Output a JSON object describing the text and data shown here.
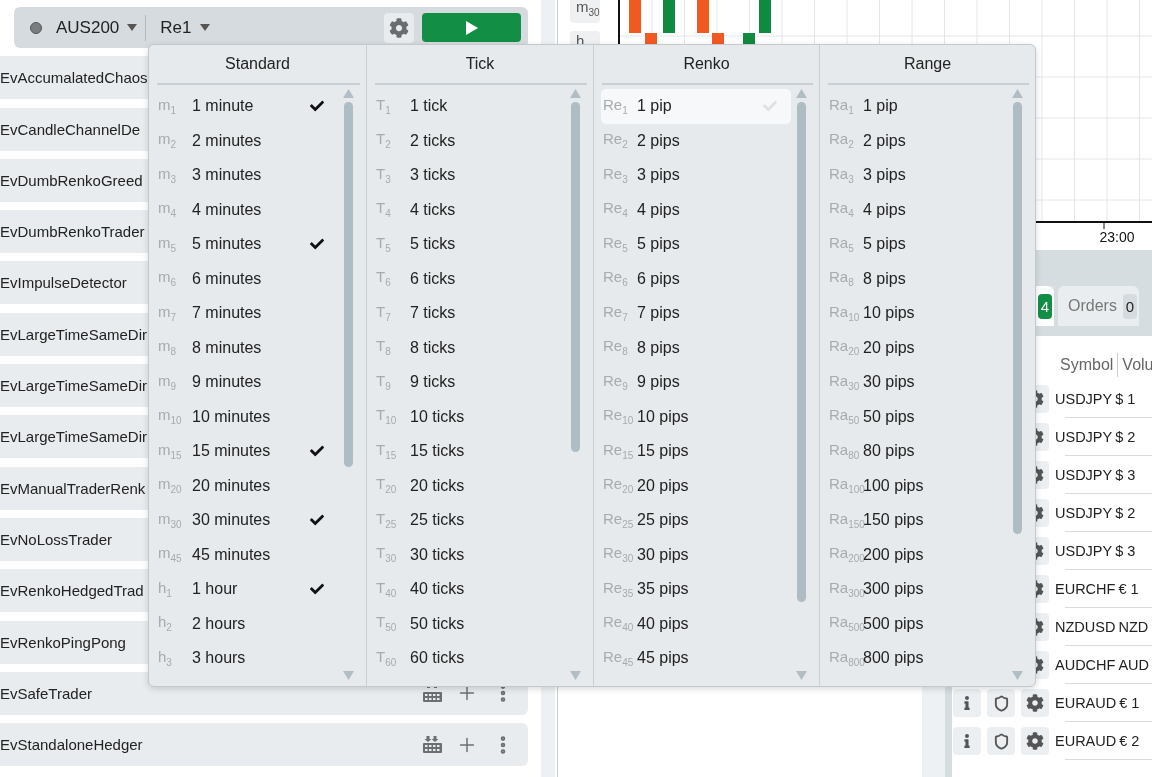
{
  "toolbar": {
    "symbol": "AUS200",
    "chart_type": "Re1"
  },
  "strategies": [
    {
      "name": "EvAccumalatedChaos"
    },
    {
      "name": "EvCandleChannelDe"
    },
    {
      "name": "EvDumbRenkoGreed"
    },
    {
      "name": "EvDumbRenkoTrader"
    },
    {
      "name": "EvImpulseDetector"
    },
    {
      "name": "EvLargeTimeSameDir"
    },
    {
      "name": "EvLargeTimeSameDir"
    },
    {
      "name": "EvLargeTimeSameDir"
    },
    {
      "name": "EvManualTraderRenk"
    },
    {
      "name": "EvNoLossTrader"
    },
    {
      "name": "EvRenkoHedgedTrad"
    },
    {
      "name": "EvRenkoPingPong"
    },
    {
      "name": "EvSafeTrader"
    },
    {
      "name": "EvStandaloneHedger"
    }
  ],
  "chart": {
    "timeframes": [
      {
        "prefix": "m",
        "sub": "30"
      },
      {
        "prefix": "h"
      }
    ],
    "time_label": "23:00"
  },
  "bottom_tabs": [
    {
      "badge": "4",
      "selected": true
    },
    {
      "label": "Orders",
      "badge": "0",
      "selected": false
    }
  ],
  "positions": {
    "columns": [
      "Symbol",
      "Volu"
    ],
    "rows": [
      {
        "symbol": "USDJPY",
        "volume": "$ 1"
      },
      {
        "symbol": "USDJPY",
        "volume": "$ 2"
      },
      {
        "symbol": "USDJPY",
        "volume": "$ 3"
      },
      {
        "symbol": "USDJPY",
        "volume": "$ 2"
      },
      {
        "symbol": "USDJPY",
        "volume": "$ 3"
      },
      {
        "symbol": "EURCHF",
        "volume": "€ 1"
      },
      {
        "symbol": "NZDUSD",
        "volume": "NZD"
      },
      {
        "symbol": "AUDCHF",
        "volume": "AUD"
      },
      {
        "symbol": "EURAUD",
        "volume": "€ 1"
      },
      {
        "symbol": "EURAUD",
        "volume": "€ 2"
      }
    ]
  },
  "dropdown": {
    "columns": [
      {
        "title": "Standard",
        "items": [
          {
            "prefix": "m",
            "sub": "1",
            "label": "1 minute",
            "checked": true,
            "selected": false
          },
          {
            "prefix": "m",
            "sub": "2",
            "label": "2 minutes",
            "checked": false,
            "selected": false
          },
          {
            "prefix": "m",
            "sub": "3",
            "label": "3 minutes",
            "checked": false,
            "selected": false
          },
          {
            "prefix": "m",
            "sub": "4",
            "label": "4 minutes",
            "checked": false,
            "selected": false
          },
          {
            "prefix": "m",
            "sub": "5",
            "label": "5 minutes",
            "checked": true,
            "selected": false
          },
          {
            "prefix": "m",
            "sub": "6",
            "label": "6 minutes",
            "checked": false,
            "selected": false
          },
          {
            "prefix": "m",
            "sub": "7",
            "label": "7 minutes",
            "checked": false,
            "selected": false
          },
          {
            "prefix": "m",
            "sub": "8",
            "label": "8 minutes",
            "checked": false,
            "selected": false
          },
          {
            "prefix": "m",
            "sub": "9",
            "label": "9 minutes",
            "checked": false,
            "selected": false
          },
          {
            "prefix": "m",
            "sub": "10",
            "label": "10 minutes",
            "checked": false,
            "selected": false
          },
          {
            "prefix": "m",
            "sub": "15",
            "label": "15 minutes",
            "checked": true,
            "selected": false
          },
          {
            "prefix": "m",
            "sub": "20",
            "label": "20 minutes",
            "checked": false,
            "selected": false
          },
          {
            "prefix": "m",
            "sub": "30",
            "label": "30 minutes",
            "checked": true,
            "selected": false
          },
          {
            "prefix": "m",
            "sub": "45",
            "label": "45 minutes",
            "checked": false,
            "selected": false
          },
          {
            "prefix": "h",
            "sub": "1",
            "label": "1 hour",
            "checked": true,
            "selected": false
          },
          {
            "prefix": "h",
            "sub": "2",
            "label": "2 hours",
            "checked": false,
            "selected": false
          },
          {
            "prefix": "h",
            "sub": "3",
            "label": "3 hours",
            "checked": false,
            "selected": false
          }
        ]
      },
      {
        "title": "Tick",
        "items": [
          {
            "prefix": "T",
            "sub": "1",
            "label": "1 tick",
            "checked": false,
            "selected": false
          },
          {
            "prefix": "T",
            "sub": "2",
            "label": "2 ticks",
            "checked": false,
            "selected": false
          },
          {
            "prefix": "T",
            "sub": "3",
            "label": "3 ticks",
            "checked": false,
            "selected": false
          },
          {
            "prefix": "T",
            "sub": "4",
            "label": "4 ticks",
            "checked": false,
            "selected": false
          },
          {
            "prefix": "T",
            "sub": "5",
            "label": "5 ticks",
            "checked": false,
            "selected": false
          },
          {
            "prefix": "T",
            "sub": "6",
            "label": "6 ticks",
            "checked": false,
            "selected": false
          },
          {
            "prefix": "T",
            "sub": "7",
            "label": "7 ticks",
            "checked": false,
            "selected": false
          },
          {
            "prefix": "T",
            "sub": "8",
            "label": "8 ticks",
            "checked": false,
            "selected": false
          },
          {
            "prefix": "T",
            "sub": "9",
            "label": "9 ticks",
            "checked": false,
            "selected": false
          },
          {
            "prefix": "T",
            "sub": "10",
            "label": "10 ticks",
            "checked": false,
            "selected": false
          },
          {
            "prefix": "T",
            "sub": "15",
            "label": "15 ticks",
            "checked": false,
            "selected": false
          },
          {
            "prefix": "T",
            "sub": "20",
            "label": "20 ticks",
            "checked": false,
            "selected": false
          },
          {
            "prefix": "T",
            "sub": "25",
            "label": "25 ticks",
            "checked": false,
            "selected": false
          },
          {
            "prefix": "T",
            "sub": "30",
            "label": "30 ticks",
            "checked": false,
            "selected": false
          },
          {
            "prefix": "T",
            "sub": "40",
            "label": "40 ticks",
            "checked": false,
            "selected": false
          },
          {
            "prefix": "T",
            "sub": "50",
            "label": "50 ticks",
            "checked": false,
            "selected": false
          },
          {
            "prefix": "T",
            "sub": "60",
            "label": "60 ticks",
            "checked": false,
            "selected": false
          }
        ]
      },
      {
        "title": "Renko",
        "items": [
          {
            "prefix": "Re",
            "sub": "1",
            "label": "1 pip",
            "checked": false,
            "selected": true
          },
          {
            "prefix": "Re",
            "sub": "2",
            "label": "2 pips",
            "checked": false,
            "selected": false
          },
          {
            "prefix": "Re",
            "sub": "3",
            "label": "3 pips",
            "checked": false,
            "selected": false
          },
          {
            "prefix": "Re",
            "sub": "4",
            "label": "4 pips",
            "checked": false,
            "selected": false
          },
          {
            "prefix": "Re",
            "sub": "5",
            "label": "5 pips",
            "checked": false,
            "selected": false
          },
          {
            "prefix": "Re",
            "sub": "6",
            "label": "6 pips",
            "checked": false,
            "selected": false
          },
          {
            "prefix": "Re",
            "sub": "7",
            "label": "7 pips",
            "checked": false,
            "selected": false
          },
          {
            "prefix": "Re",
            "sub": "8",
            "label": "8 pips",
            "checked": false,
            "selected": false
          },
          {
            "prefix": "Re",
            "sub": "9",
            "label": "9 pips",
            "checked": false,
            "selected": false
          },
          {
            "prefix": "Re",
            "sub": "10",
            "label": "10 pips",
            "checked": false,
            "selected": false
          },
          {
            "prefix": "Re",
            "sub": "15",
            "label": "15 pips",
            "checked": false,
            "selected": false
          },
          {
            "prefix": "Re",
            "sub": "20",
            "label": "20 pips",
            "checked": false,
            "selected": false
          },
          {
            "prefix": "Re",
            "sub": "25",
            "label": "25 pips",
            "checked": false,
            "selected": false
          },
          {
            "prefix": "Re",
            "sub": "30",
            "label": "30 pips",
            "checked": false,
            "selected": false
          },
          {
            "prefix": "Re",
            "sub": "35",
            "label": "35 pips",
            "checked": false,
            "selected": false
          },
          {
            "prefix": "Re",
            "sub": "40",
            "label": "40 pips",
            "checked": false,
            "selected": false
          },
          {
            "prefix": "Re",
            "sub": "45",
            "label": "45 pips",
            "checked": false,
            "selected": false
          }
        ]
      },
      {
        "title": "Range",
        "items": [
          {
            "prefix": "Ra",
            "sub": "1",
            "label": "1 pip",
            "checked": false,
            "selected": false
          },
          {
            "prefix": "Ra",
            "sub": "2",
            "label": "2 pips",
            "checked": false,
            "selected": false
          },
          {
            "prefix": "Ra",
            "sub": "3",
            "label": "3 pips",
            "checked": false,
            "selected": false
          },
          {
            "prefix": "Ra",
            "sub": "4",
            "label": "4 pips",
            "checked": false,
            "selected": false
          },
          {
            "prefix": "Ra",
            "sub": "5",
            "label": "5 pips",
            "checked": false,
            "selected": false
          },
          {
            "prefix": "Ra",
            "sub": "8",
            "label": "8 pips",
            "checked": false,
            "selected": false
          },
          {
            "prefix": "Ra",
            "sub": "10",
            "label": "10 pips",
            "checked": false,
            "selected": false
          },
          {
            "prefix": "Ra",
            "sub": "20",
            "label": "20 pips",
            "checked": false,
            "selected": false
          },
          {
            "prefix": "Ra",
            "sub": "30",
            "label": "30 pips",
            "checked": false,
            "selected": false
          },
          {
            "prefix": "Ra",
            "sub": "50",
            "label": "50 pips",
            "checked": false,
            "selected": false
          },
          {
            "prefix": "Ra",
            "sub": "80",
            "label": "80 pips",
            "checked": false,
            "selected": false
          },
          {
            "prefix": "Ra",
            "sub": "100",
            "label": "100 pips",
            "checked": false,
            "selected": false
          },
          {
            "prefix": "Ra",
            "sub": "150",
            "label": "150 pips",
            "checked": false,
            "selected": false
          },
          {
            "prefix": "Ra",
            "sub": "200",
            "label": "200 pips",
            "checked": false,
            "selected": false
          },
          {
            "prefix": "Ra",
            "sub": "300",
            "label": "300 pips",
            "checked": false,
            "selected": false
          },
          {
            "prefix": "Ra",
            "sub": "500",
            "label": "500 pips",
            "checked": false,
            "selected": false
          },
          {
            "prefix": "Ra",
            "sub": "800",
            "label": "800 pips",
            "checked": false,
            "selected": false
          }
        ]
      }
    ]
  }
}
